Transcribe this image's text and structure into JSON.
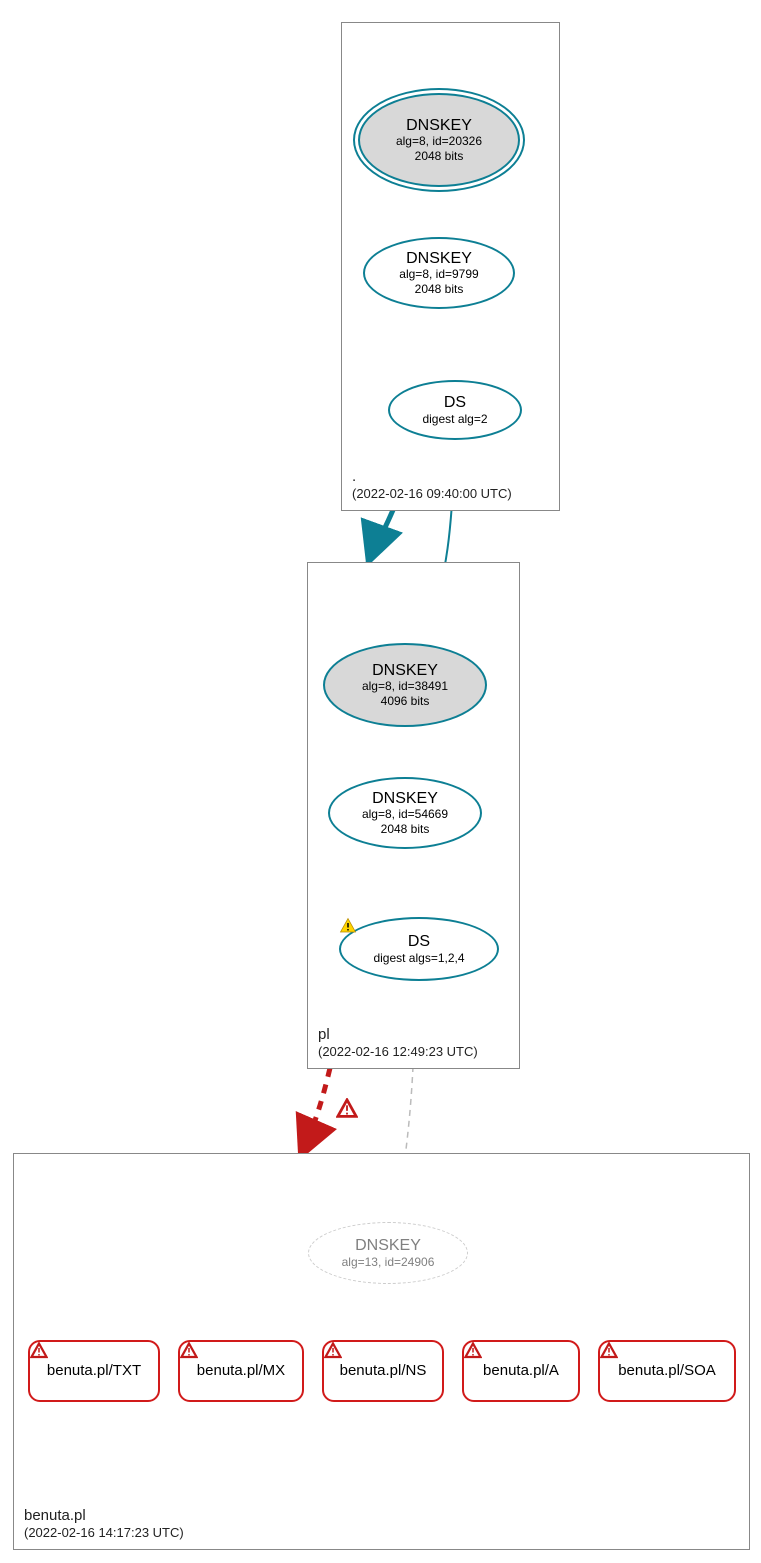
{
  "zones": {
    "root": {
      "label": ".",
      "timestamp": "(2022-02-16 09:40:00 UTC)",
      "ksk": {
        "title": "DNSKEY",
        "sub1": "alg=8, id=20326",
        "sub2": "2048 bits"
      },
      "zsk": {
        "title": "DNSKEY",
        "sub1": "alg=8, id=9799",
        "sub2": "2048 bits"
      },
      "ds": {
        "title": "DS",
        "sub1": "digest alg=2"
      }
    },
    "pl": {
      "label": "pl",
      "timestamp": "(2022-02-16 12:49:23 UTC)",
      "ksk": {
        "title": "DNSKEY",
        "sub1": "alg=8, id=38491",
        "sub2": "4096 bits"
      },
      "zsk": {
        "title": "DNSKEY",
        "sub1": "alg=8, id=54669",
        "sub2": "2048 bits"
      },
      "ds": {
        "title": "DS",
        "sub1": "digest algs=1,2,4"
      }
    },
    "benuta": {
      "label": "benuta.pl",
      "timestamp": "(2022-02-16 14:17:23 UTC)",
      "dnskey": {
        "title": "DNSKEY",
        "sub1": "alg=13, id=24906"
      },
      "rr": {
        "txt": "benuta.pl/TXT",
        "mx": "benuta.pl/MX",
        "ns": "benuta.pl/NS",
        "a": "benuta.pl/A",
        "soa": "benuta.pl/SOA"
      }
    }
  }
}
